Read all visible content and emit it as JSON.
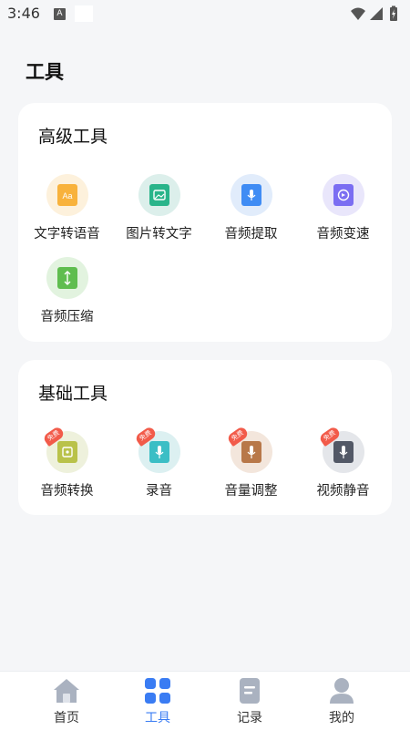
{
  "status_bar": {
    "time": "3:46",
    "notification_letter": "A"
  },
  "page": {
    "title": "工具"
  },
  "advanced": {
    "title": "高级工具",
    "tools": [
      {
        "label": "文字转语音",
        "icon": "text-to-speech-icon",
        "icon_text": "Aa",
        "bg": "#fdf1dc",
        "color": "#f8b23c"
      },
      {
        "label": "图片转文字",
        "icon": "image-to-text-icon",
        "bg": "#dcefeb",
        "color": "#29b48a"
      },
      {
        "label": "音频提取",
        "icon": "audio-extract-icon",
        "bg": "#e1ecfb",
        "color": "#3f8cf4"
      },
      {
        "label": "音频变速",
        "icon": "audio-speed-icon",
        "bg": "#e9e6fb",
        "color": "#7b6ef2"
      },
      {
        "label": "音频压缩",
        "icon": "audio-compress-icon",
        "bg": "#e2f3df",
        "color": "#5fbd4f"
      }
    ]
  },
  "basic": {
    "title": "基础工具",
    "free_badge": "免费",
    "tools": [
      {
        "label": "音频转换",
        "icon": "audio-convert-icon",
        "bg": "#eef1dc",
        "color": "#b9c24a"
      },
      {
        "label": "录音",
        "icon": "record-icon",
        "bg": "#dcf0f1",
        "color": "#3bbec5"
      },
      {
        "label": "音量调整",
        "icon": "volume-adjust-icon",
        "bg": "#f3e6dc",
        "color": "#b87849"
      },
      {
        "label": "视频静音",
        "icon": "video-mute-icon",
        "bg": "#e4e6ea",
        "color": "#525866"
      }
    ]
  },
  "tabbar": {
    "active_color": "#3a7cf3",
    "items": [
      {
        "label": "首页",
        "icon": "home-icon"
      },
      {
        "label": "工具",
        "icon": "tools-icon",
        "active": true
      },
      {
        "label": "记录",
        "icon": "record-list-icon"
      },
      {
        "label": "我的",
        "icon": "profile-icon"
      }
    ]
  }
}
